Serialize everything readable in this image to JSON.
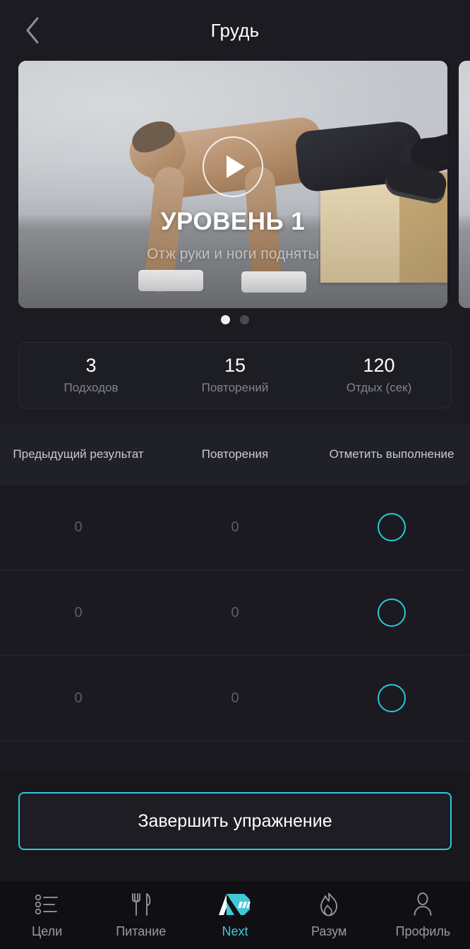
{
  "header": {
    "title": "Грудь",
    "back_icon": "chevron-left-icon"
  },
  "carousel": {
    "slides": [
      {
        "level": "УРОВЕНЬ 1",
        "subtitle": "Отж руки и ноги подняты",
        "play_icon": "play-icon"
      },
      {
        "level": "",
        "subtitle": "",
        "play_icon": "play-icon"
      }
    ],
    "dots": [
      {
        "active": true
      },
      {
        "active": false
      }
    ]
  },
  "stats": [
    {
      "value": "3",
      "label": "Подходов"
    },
    {
      "value": "15",
      "label": "Повторений"
    },
    {
      "value": "120",
      "label": "Отдых (сек)"
    }
  ],
  "table": {
    "headers": [
      "Предыдущий результат",
      "Повторения",
      "Отметить выполнение"
    ],
    "rows": [
      {
        "previous": "0",
        "reps": "0",
        "done": false
      },
      {
        "previous": "0",
        "reps": "0",
        "done": false
      },
      {
        "previous": "0",
        "reps": "0",
        "done": false
      }
    ]
  },
  "cta": {
    "label": "Завершить упражнение"
  },
  "nav": {
    "items": [
      {
        "label": "Цели",
        "icon": "list-icon",
        "active": false
      },
      {
        "label": "Питание",
        "icon": "cutlery-icon",
        "active": false
      },
      {
        "label": "Next",
        "icon": "next-logo-icon",
        "active": true
      },
      {
        "label": "Разум",
        "icon": "flame-icon",
        "active": false
      },
      {
        "label": "Профиль",
        "icon": "person-icon",
        "active": false
      }
    ]
  },
  "colors": {
    "accent": "#2ec7d8",
    "background": "#17171c",
    "surface": "#1b1b21",
    "text_primary": "#ffffff",
    "text_muted": "#83838c"
  }
}
